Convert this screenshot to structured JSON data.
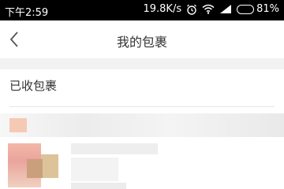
{
  "status_bar": {
    "time": "下午2:59",
    "network_speed": "19.8K/s",
    "battery": "81%",
    "icons": [
      "alarm-icon",
      "wifi-icon",
      "signal-icon",
      "battery-icon"
    ]
  },
  "nav": {
    "title": "我的包裹",
    "back_icon": "chevron-left-icon"
  },
  "section": {
    "title": "已收包裹"
  },
  "colors": {
    "status_bar_bg": "#000000",
    "page_bg": "#ffffff",
    "gap_bg": "#f2f2f2",
    "text": "#333333"
  }
}
